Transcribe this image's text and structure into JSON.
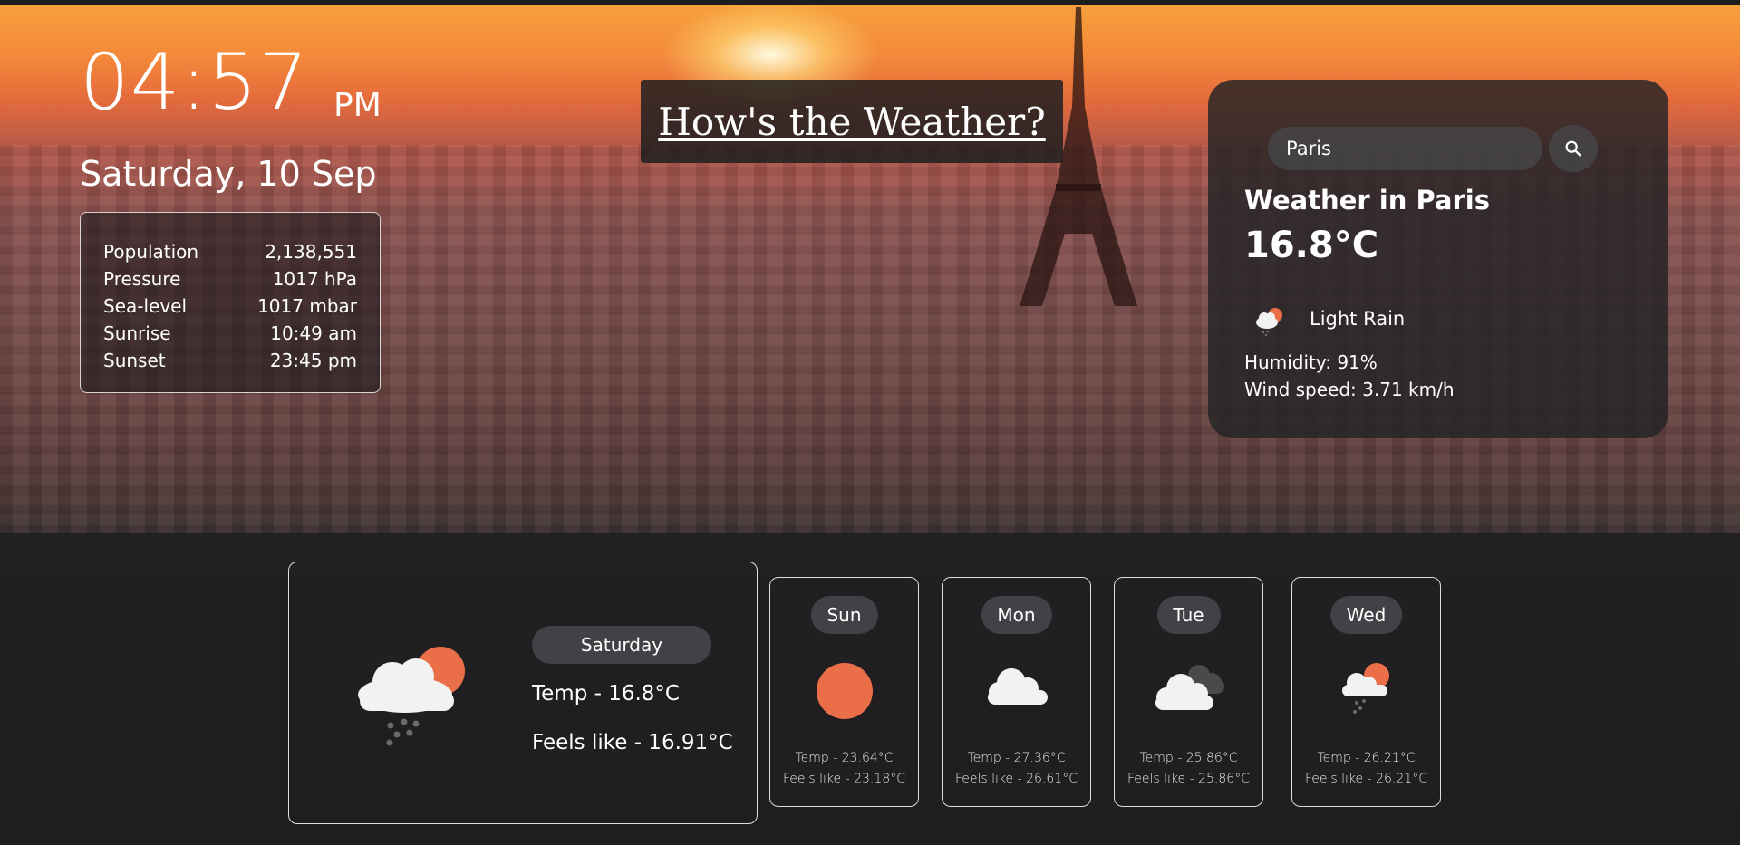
{
  "clock": {
    "time": "04:57",
    "ampm": "PM",
    "date": "Saturday, 10 Sep"
  },
  "city_info": {
    "rows": [
      {
        "label": "Population",
        "value": "2,138,551"
      },
      {
        "label": "Pressure",
        "value": "1017 hPa"
      },
      {
        "label": "Sea-level",
        "value": "1017 mbar"
      },
      {
        "label": "Sunrise",
        "value": "10:49 am"
      },
      {
        "label": "Sunset",
        "value": "23:45 pm"
      }
    ]
  },
  "header": {
    "title": "How's the Weather?"
  },
  "search": {
    "value": "Paris",
    "icon": "search-icon"
  },
  "current": {
    "title": "Weather in Paris",
    "temp": "16.8°C",
    "description": "Light Rain",
    "icon": "light-rain-icon",
    "humidity": "Humidity: 91%",
    "wind": "Wind speed: 3.71 km/h"
  },
  "today": {
    "day": "Saturday",
    "temp": "Temp - 16.8°C",
    "feels": "Feels like - 16.91°C",
    "icon": "light-rain-icon"
  },
  "forecast": [
    {
      "day": "Sun",
      "temp": "Temp - 23.64°C",
      "feels": "Feels like - 23.18°C",
      "icon": "sun-icon"
    },
    {
      "day": "Mon",
      "temp": "Temp - 27.36°C",
      "feels": "Feels like - 26.61°C",
      "icon": "cloud-icon"
    },
    {
      "day": "Tue",
      "temp": "Temp - 25.86°C",
      "feels": "Feels like - 25.86°C",
      "icon": "broken-clouds-icon"
    },
    {
      "day": "Wed",
      "temp": "Temp - 26.21°C",
      "feels": "Feels like - 26.21°C",
      "icon": "light-rain-icon"
    }
  ],
  "colors": {
    "sun": "#ea6e48",
    "cloud": "#f2f2f2",
    "dark_cloud": "#5a5a5a",
    "card_bg": "#232326"
  }
}
